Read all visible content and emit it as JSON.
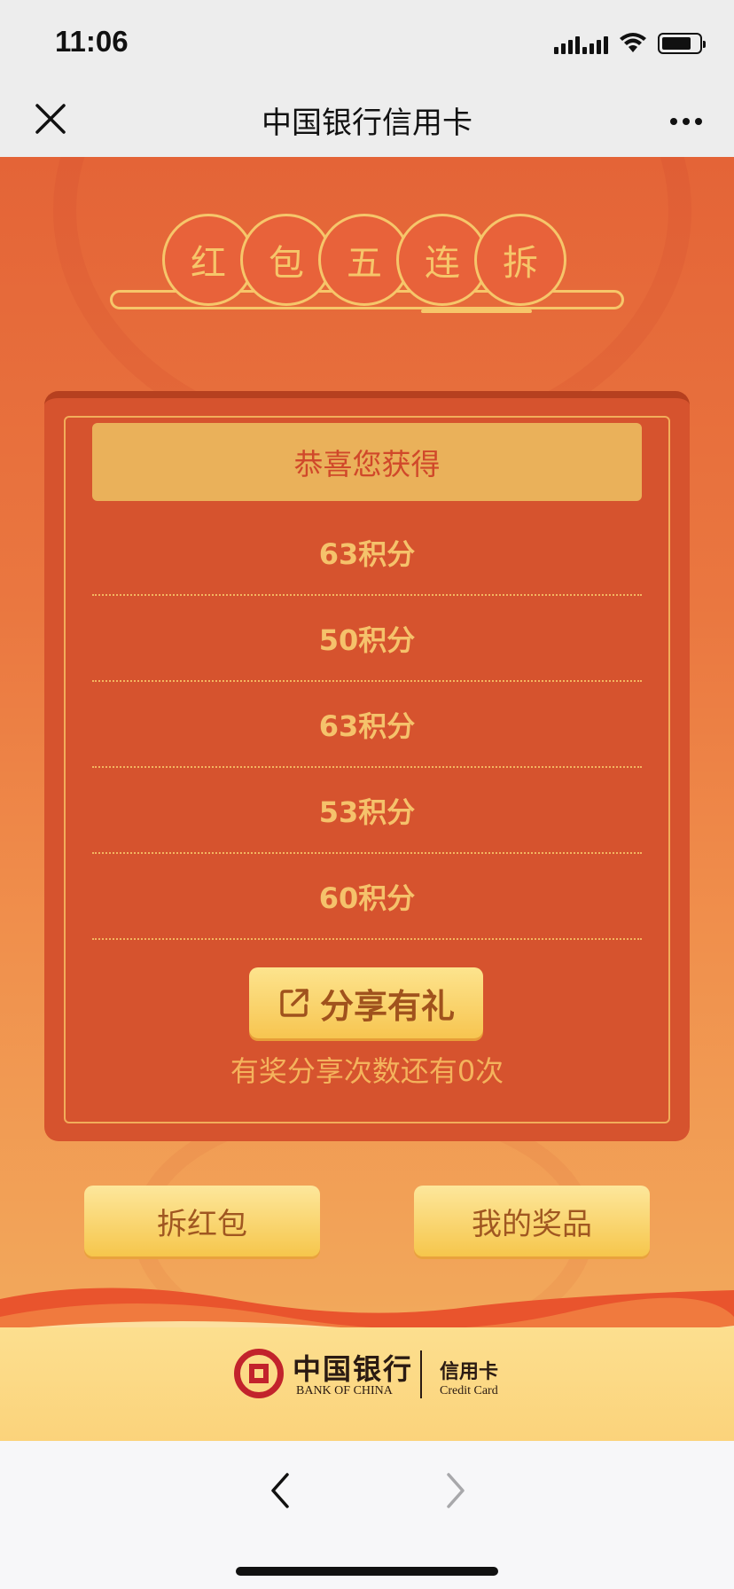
{
  "status_bar": {
    "time": "11:06"
  },
  "nav": {
    "title": "中国银行信用卡"
  },
  "title_chars": [
    "红",
    "包",
    "五",
    "连",
    "拆"
  ],
  "card": {
    "heading": "恭喜您获得",
    "prizes": [
      "63积分",
      "50积分",
      "63积分",
      "53积分",
      "60积分"
    ],
    "share_button": "分享有礼",
    "share_note": "有奖分享次数还有0次"
  },
  "buttons": {
    "open_packet": "拆红包",
    "my_prizes": "我的奖品"
  },
  "footer": {
    "brand_cn": "中国银行",
    "brand_en": "BANK OF CHINA",
    "product_cn": "信用卡",
    "product_en": "Credit Card"
  },
  "colors": {
    "primary_red": "#d6532e",
    "gold": "#f6c66a",
    "brand_red": "#c2232c"
  }
}
